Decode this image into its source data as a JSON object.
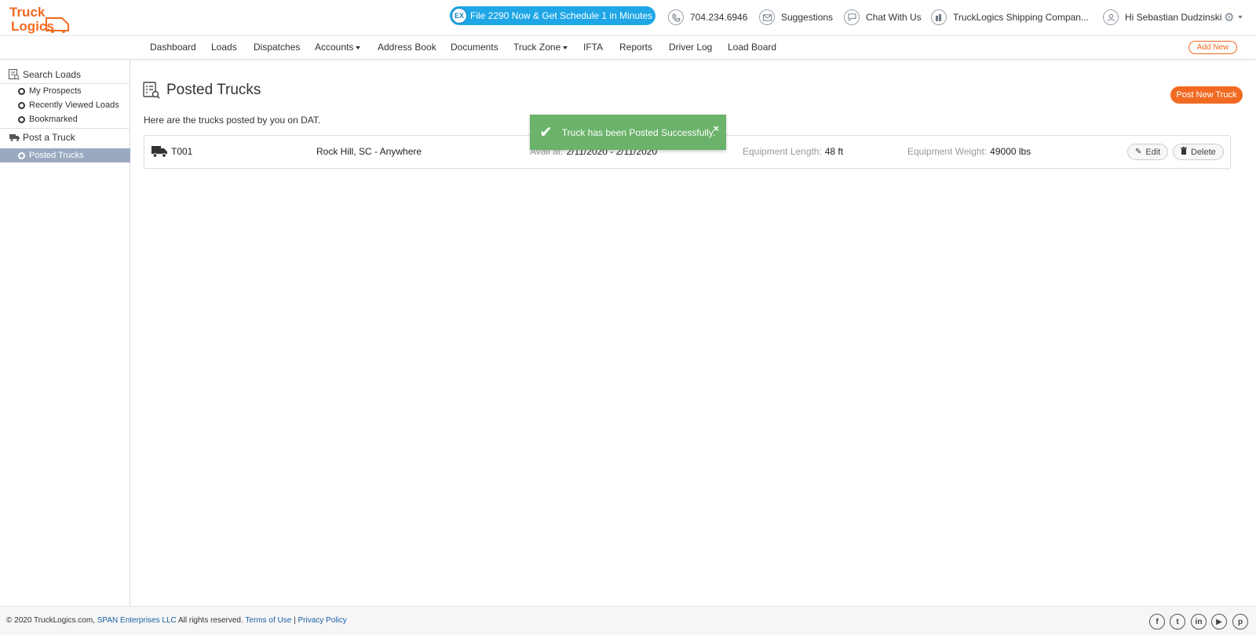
{
  "header": {
    "logo_line1": "Truck",
    "logo_line2": "Logics",
    "promo": "File 2290 Now & Get Schedule 1 in Minutes",
    "promo_icon": "EX",
    "phone": "704.234.6946",
    "suggestions": "Suggestions",
    "chat": "Chat With Us",
    "company": "TruckLogics Shipping Compan...",
    "user": "Hi Sebastian Dudzinski"
  },
  "nav": {
    "items": [
      {
        "label": "Dashboard"
      },
      {
        "label": "Loads"
      },
      {
        "label": "Dispatches"
      },
      {
        "label": "Accounts"
      },
      {
        "label": "Address Book"
      },
      {
        "label": "Documents"
      },
      {
        "label": "Truck Zone"
      },
      {
        "label": "IFTA"
      },
      {
        "label": "Reports"
      },
      {
        "label": "Driver Log"
      },
      {
        "label": "Load Board"
      }
    ],
    "add_new": "Add New"
  },
  "sidebar": {
    "search_loads": "Search Loads",
    "my_prospects": "My Prospects",
    "recently_viewed": "Recently Viewed Loads",
    "bookmarked": "Bookmarked",
    "post_truck": "Post a Truck",
    "posted_trucks": "Posted Trucks"
  },
  "main": {
    "title": "Posted Trucks",
    "post_new_button": "Post New Truck",
    "subtitle": "Here are the trucks posted by you on DAT.",
    "truck": {
      "id": "T001",
      "route": "Rock Hill, SC - Anywhere",
      "avail_label": "Avail at:",
      "avail_value": "2/11/2020 - 2/11/2020",
      "length_label": "Equipment Length:",
      "length_value": "48 ft",
      "weight_label": "Equipment Weight:",
      "weight_value": "49000 lbs",
      "edit": "Edit",
      "delete": "Delete"
    }
  },
  "toast": {
    "message": "Truck has been Posted Successfully.",
    "close": "×"
  },
  "footer": {
    "copyright": "© 2020 TruckLogics.com,",
    "company_link": "SPAN Enterprises LLC",
    "rights": "All rights reserved.",
    "terms": "Terms of Use",
    "separator": "|",
    "privacy": "Privacy Policy",
    "social": [
      "f",
      "t",
      "in",
      "▶",
      "p"
    ]
  },
  "colors": {
    "brand_orange": "#f26a21",
    "promo_blue": "#1ea6e6",
    "toast_green": "#6bb26a",
    "sidebar_active": "#9aa9c0"
  }
}
